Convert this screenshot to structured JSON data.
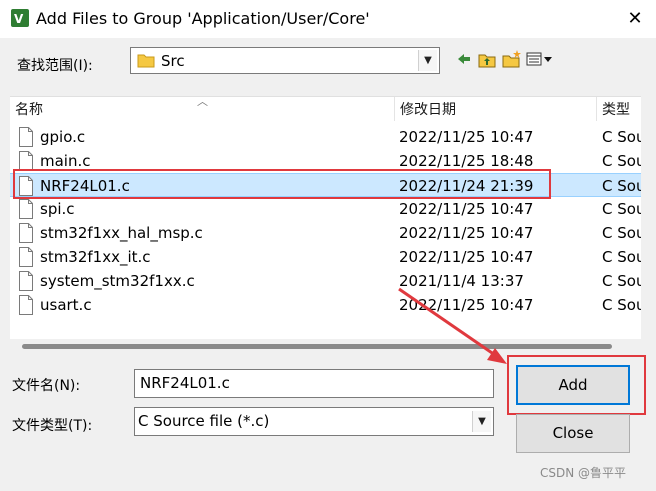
{
  "window": {
    "title": "Add Files to Group 'Application/User/Core'"
  },
  "look_in": {
    "label": "查找范围(I):",
    "value": "Src"
  },
  "toolbar": {
    "icons": [
      "back-arrow-icon",
      "up-folder-icon",
      "new-folder-icon",
      "view-menu-icon"
    ]
  },
  "file_list": {
    "columns": [
      "名称",
      "修改日期",
      "类型"
    ],
    "rows": [
      {
        "name": "gpio.c",
        "date": "2022/11/25 10:47",
        "type": "C Sou"
      },
      {
        "name": "main.c",
        "date": "2022/11/25 18:48",
        "type": "C Sou"
      },
      {
        "name": "NRF24L01.c",
        "date": "2022/11/24 21:39",
        "type": "C Sou",
        "selected": true
      },
      {
        "name": "spi.c",
        "date": "2022/11/25 10:47",
        "type": "C Sou"
      },
      {
        "name": "stm32f1xx_hal_msp.c",
        "date": "2022/11/25 10:47",
        "type": "C Sou"
      },
      {
        "name": "stm32f1xx_it.c",
        "date": "2022/11/25 10:47",
        "type": "C Sou"
      },
      {
        "name": "system_stm32f1xx.c",
        "date": "2021/11/4 13:37",
        "type": "C Sou"
      },
      {
        "name": "usart.c",
        "date": "2022/11/25 10:47",
        "type": "C Sou"
      }
    ]
  },
  "filename": {
    "label": "文件名(N):",
    "value": "NRF24L01.c"
  },
  "filetype": {
    "label": "文件类型(T):",
    "value": "C Source file (*.c)"
  },
  "buttons": {
    "add": "Add",
    "close": "Close"
  },
  "watermark": "CSDN @鲁平平",
  "colors": {
    "highlight": "#e0393e",
    "selection": "#cce8ff"
  }
}
